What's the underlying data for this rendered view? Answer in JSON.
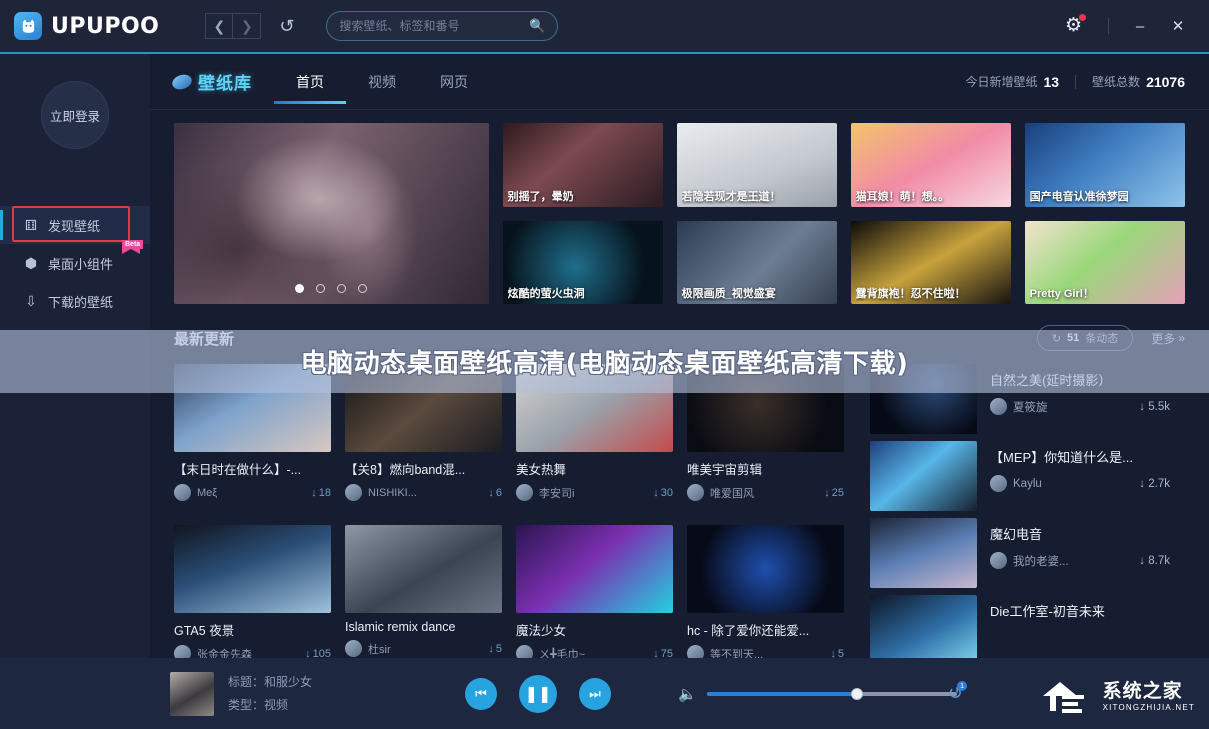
{
  "titlebar": {
    "app_name": "UPUPOO",
    "logo_icon": "cat-logo-icon",
    "back_icon": "chevron-left-icon",
    "forward_icon": "chevron-right-icon",
    "refresh_icon": "refresh-icon",
    "search_placeholder": "搜索壁纸、标签和番号",
    "search_value": "",
    "search_icon": "search-icon",
    "settings_icon": "gear-icon",
    "minimize_icon": "minimize-icon",
    "close_icon": "close-icon"
  },
  "sidebar": {
    "login_label": "立即登录",
    "items": [
      {
        "label": "发现壁纸",
        "icon": "compass-icon",
        "active": true,
        "badge": ""
      },
      {
        "label": "桌面小组件",
        "icon": "widget-icon",
        "active": false,
        "badge": "Beta"
      },
      {
        "label": "下载的壁纸",
        "icon": "download-icon",
        "active": false,
        "badge": ""
      }
    ]
  },
  "content": {
    "library_label": "壁纸库",
    "tabs": [
      {
        "label": "首页",
        "active": true
      },
      {
        "label": "视频",
        "active": false
      },
      {
        "label": "网页",
        "active": false
      }
    ],
    "stats": {
      "today_label": "今日新增壁纸",
      "today_value": "13",
      "total_label": "壁纸总数",
      "total_value": "21076"
    }
  },
  "featured": {
    "hero": {
      "caption": "",
      "dots": 4,
      "active_dot": 0
    },
    "tiles": [
      {
        "caption": "别摇了，晕奶"
      },
      {
        "caption": "若隐若现才是王道！"
      },
      {
        "caption": "猫耳娘！萌！想。。"
      },
      {
        "caption": "国产电音认准徐梦园"
      },
      {
        "caption": "炫酷的萤火虫洞"
      },
      {
        "caption": "极限画质_视觉盛宴"
      },
      {
        "caption": "露背旗袍！忍不住啦！"
      },
      {
        "caption": "Pretty Girl！"
      }
    ]
  },
  "section": {
    "title": "最新更新",
    "pill_icon": "refresh-icon",
    "pill_count": "51",
    "pill_label": "条动态",
    "more_label": "更多",
    "more_icon": "double-chevron-right-icon"
  },
  "updates": [
    {
      "title": "【末日时在做什么】-...",
      "author": "Meξ",
      "downloads": "18"
    },
    {
      "title": "【关8】燃向band混...",
      "author": "NISHIKI...",
      "downloads": "6"
    },
    {
      "title": "美女热舞",
      "author": "李安司i",
      "downloads": "30"
    },
    {
      "title": "唯美宇宙剪辑",
      "author": "唯爱国风",
      "downloads": "25"
    },
    {
      "title": "GTA5 夜景",
      "author": "张金金先森",
      "downloads": "105"
    },
    {
      "title": "Islamic remix dance",
      "author": "杜sir",
      "downloads": "5"
    },
    {
      "title": "魔法少女",
      "author": "ㄨ╋毛巾~",
      "downloads": "75"
    },
    {
      "title": "hc - 除了爱你还能爱...",
      "author": "等不到天...",
      "downloads": "5"
    }
  ],
  "right_list": [
    {
      "title": "自然之美(延时摄影）",
      "author": "夏筱旋",
      "downloads": "5.5k"
    },
    {
      "title": "【MEP】你知道什么是...",
      "author": "Kaylu",
      "downloads": "2.7k"
    },
    {
      "title": "魔幻电音",
      "author": "我的老婆...",
      "downloads": "8.7k"
    },
    {
      "title": "Die工作室-初音未来",
      "author": "",
      "downloads": ""
    }
  ],
  "watermark": {
    "text": "电脑动态桌面壁纸高清(电脑动态桌面壁纸高清下载)"
  },
  "player": {
    "title_label": "标题：和服少女",
    "type_label": "类型：视频",
    "prev_icon": "skip-previous-icon",
    "play_icon": "pause-icon",
    "next_icon": "skip-next-icon",
    "volume_icon": "volume-icon",
    "volume_percent": 60,
    "loop_icon": "loop-icon",
    "loop_badge": "1",
    "site_name": "系统之家",
    "site_domain": "XITONGZHIJIA.NET"
  }
}
